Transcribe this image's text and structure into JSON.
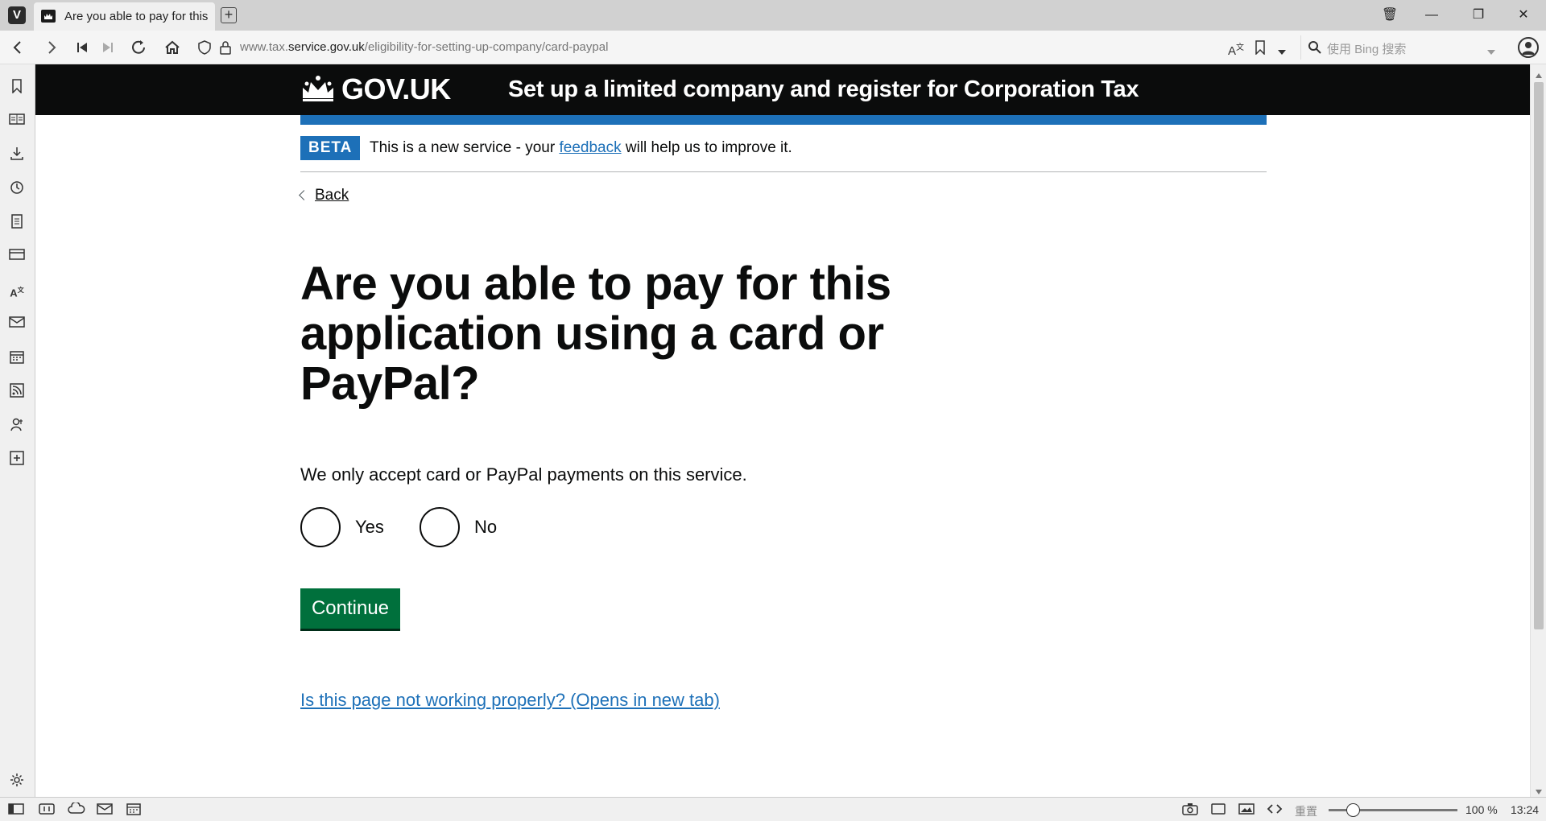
{
  "browser": {
    "tab_title": "Are you able to pay for this",
    "url_prefix": "www.tax.",
    "url_domain": "service.gov.uk",
    "url_path": "/eligibility-for-setting-up-company/card-paypal",
    "search_placeholder": "使用 Bing 搜索",
    "window_controls": {
      "trash": "🗑",
      "minimize": "—",
      "restore": "❐",
      "close": "✕"
    }
  },
  "header": {
    "logo_text": "GOV.UK",
    "service_name": "Set up a limited company and register for Corporation Tax"
  },
  "phase_banner": {
    "tag": "BETA",
    "text_before": "This is a new service - your ",
    "link_text": "feedback",
    "text_after": " will help us to improve it."
  },
  "back_link": "Back",
  "main": {
    "heading": "Are you able to pay for this application using a card or PayPal?",
    "hint": "We only accept card or PayPal payments on this service.",
    "options": [
      {
        "label": "Yes"
      },
      {
        "label": "No"
      }
    ],
    "continue_label": "Continue",
    "problem_link": "Is this page not working properly? (Opens in new tab)"
  },
  "status_bar": {
    "reset_label": "重置",
    "zoom": "100 %",
    "time": "13:24"
  },
  "colors": {
    "govuk_black": "#0b0c0c",
    "govuk_blue": "#1d70b8",
    "govuk_green": "#00703c"
  }
}
